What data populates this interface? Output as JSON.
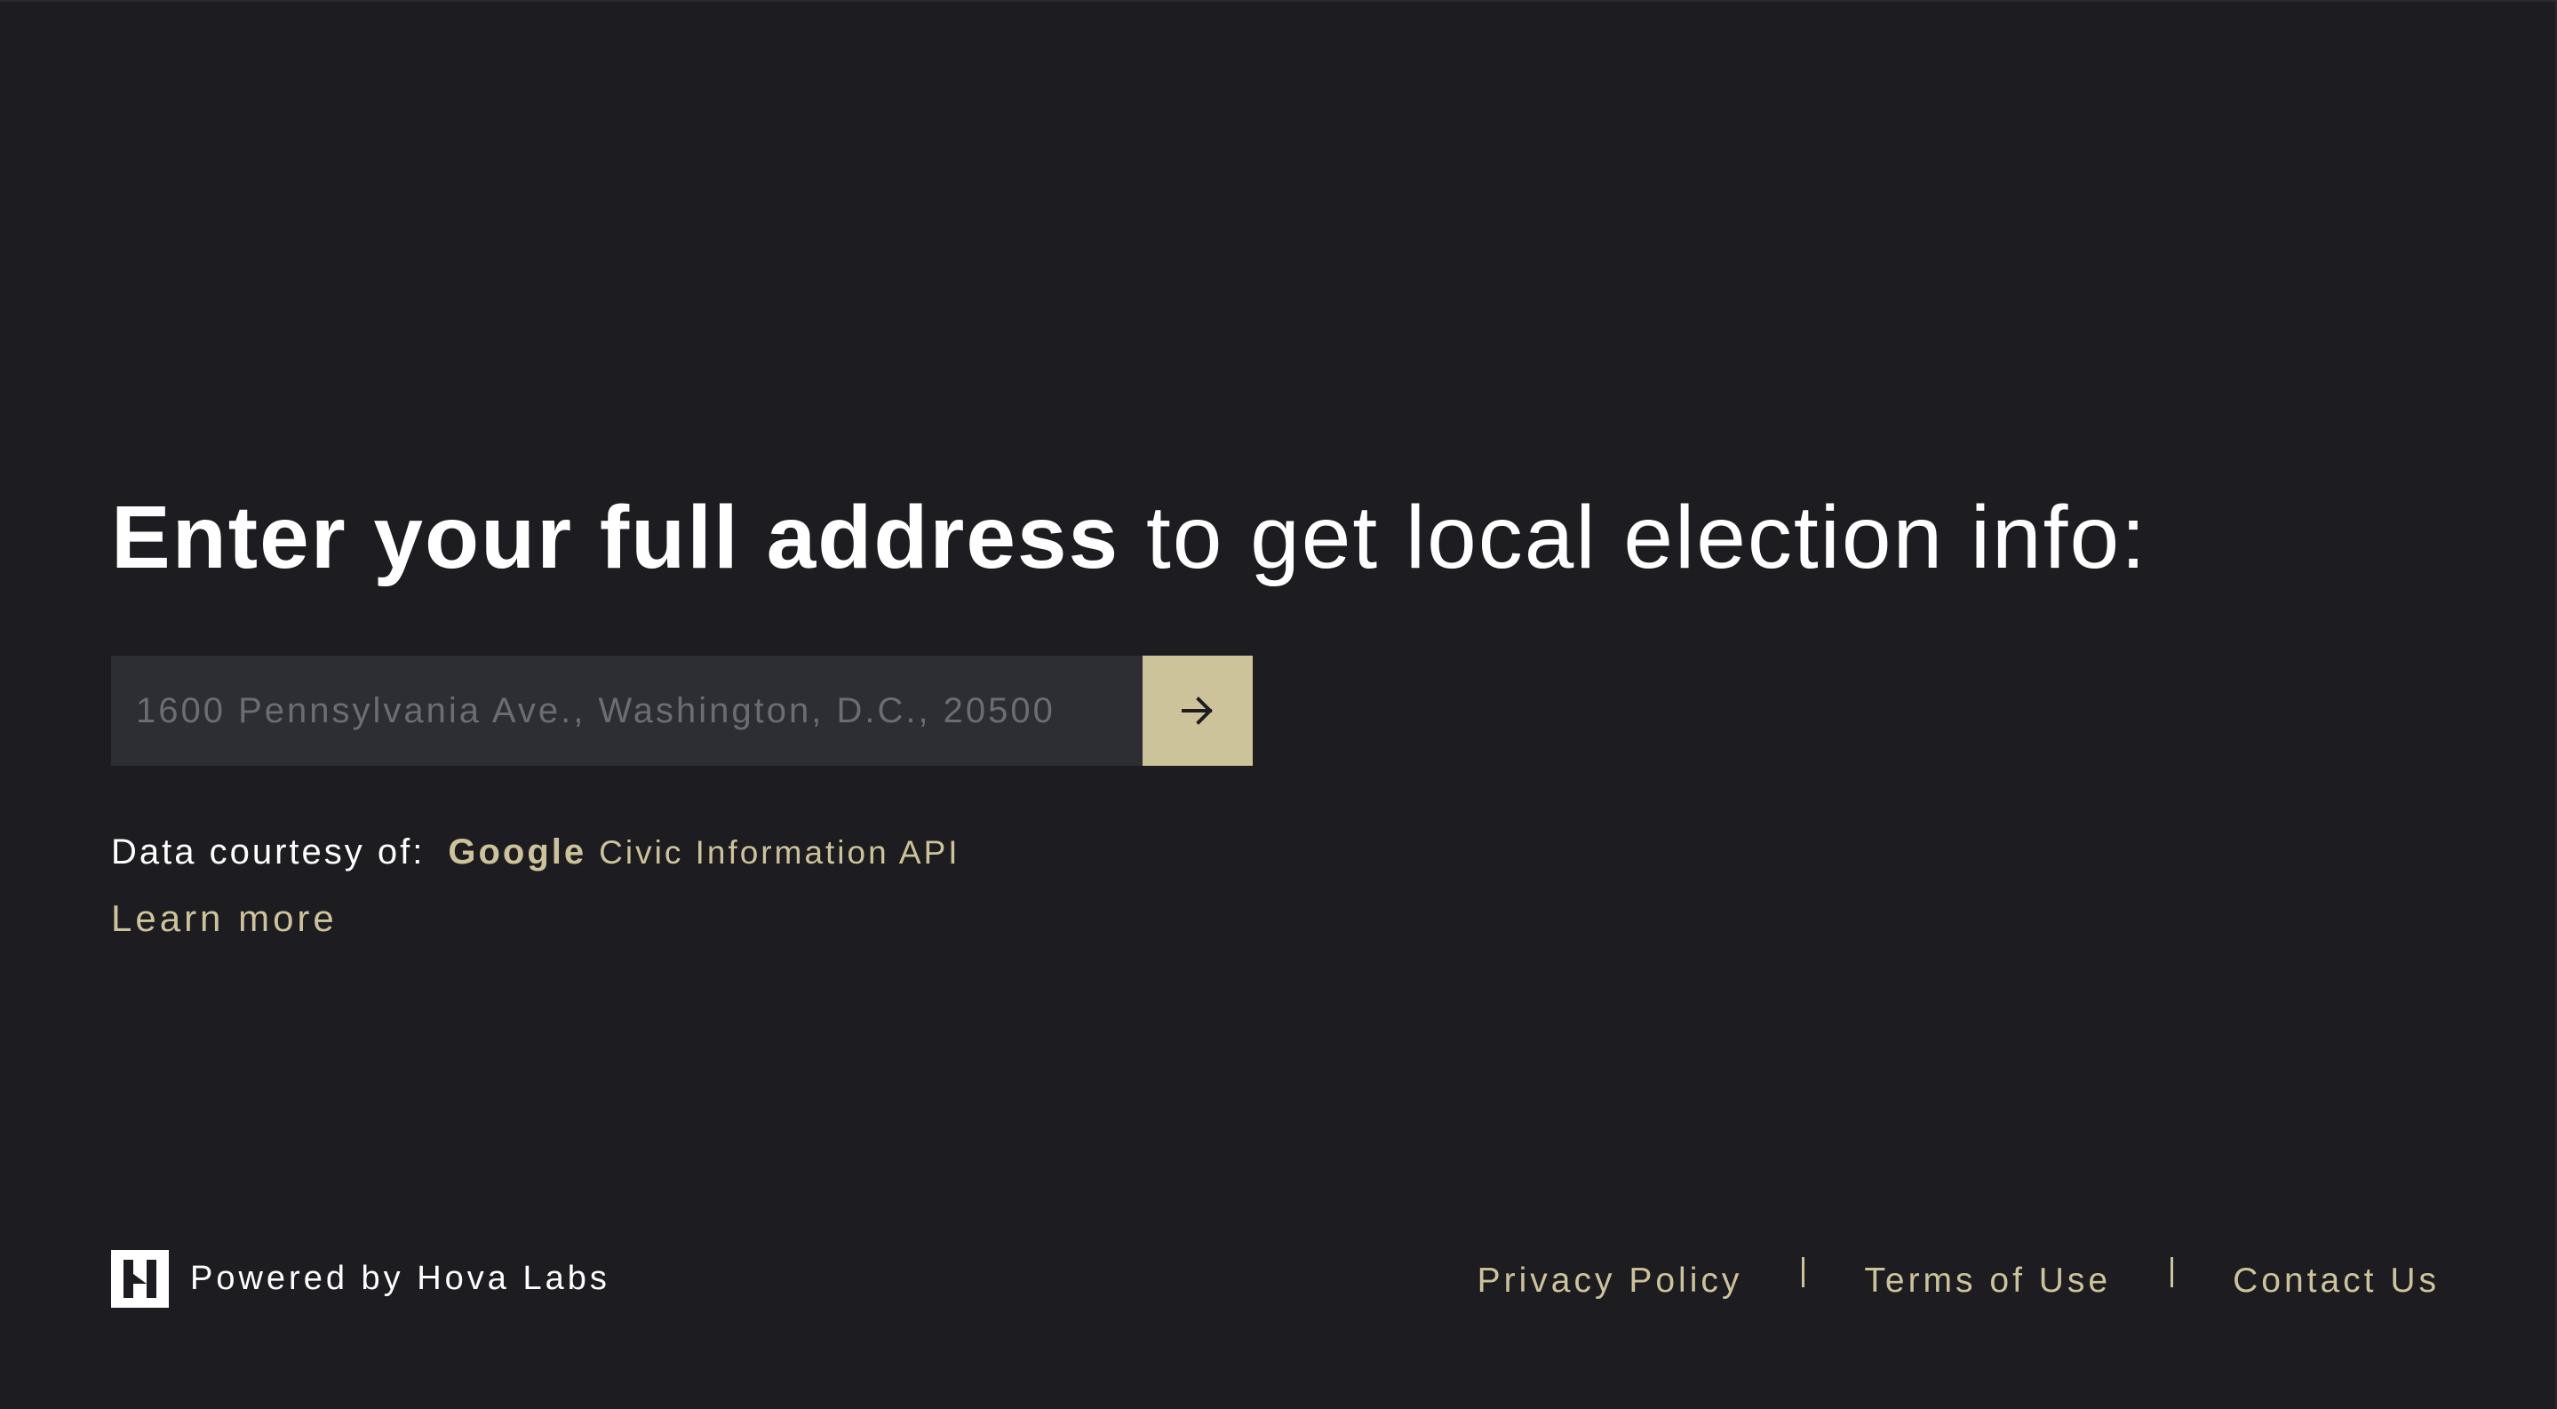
{
  "heading": {
    "bold_text": "Enter your full address",
    "regular_text": " to get local election info:"
  },
  "search": {
    "value": "",
    "placeholder": "1600 Pennsylvania Ave., Washington, D.C., 20500",
    "submit_icon": "arrow-right-icon"
  },
  "attribution": {
    "label": "Data courtesy of:",
    "provider": "Google",
    "api_name": "Civic Information API",
    "learn_more": "Learn more"
  },
  "footer": {
    "brand_icon": "hova-labs-logo-icon",
    "powered_by": "Powered by Hova Labs",
    "links": [
      {
        "label": "Privacy Policy"
      },
      {
        "label": "Terms of Use"
      },
      {
        "label": "Contact Us"
      }
    ]
  },
  "colors": {
    "background": "#1d1c21",
    "input_background": "#2d2e34",
    "accent": "#cdc39a",
    "placeholder": "#6c6d73",
    "text": "#ffffff"
  }
}
